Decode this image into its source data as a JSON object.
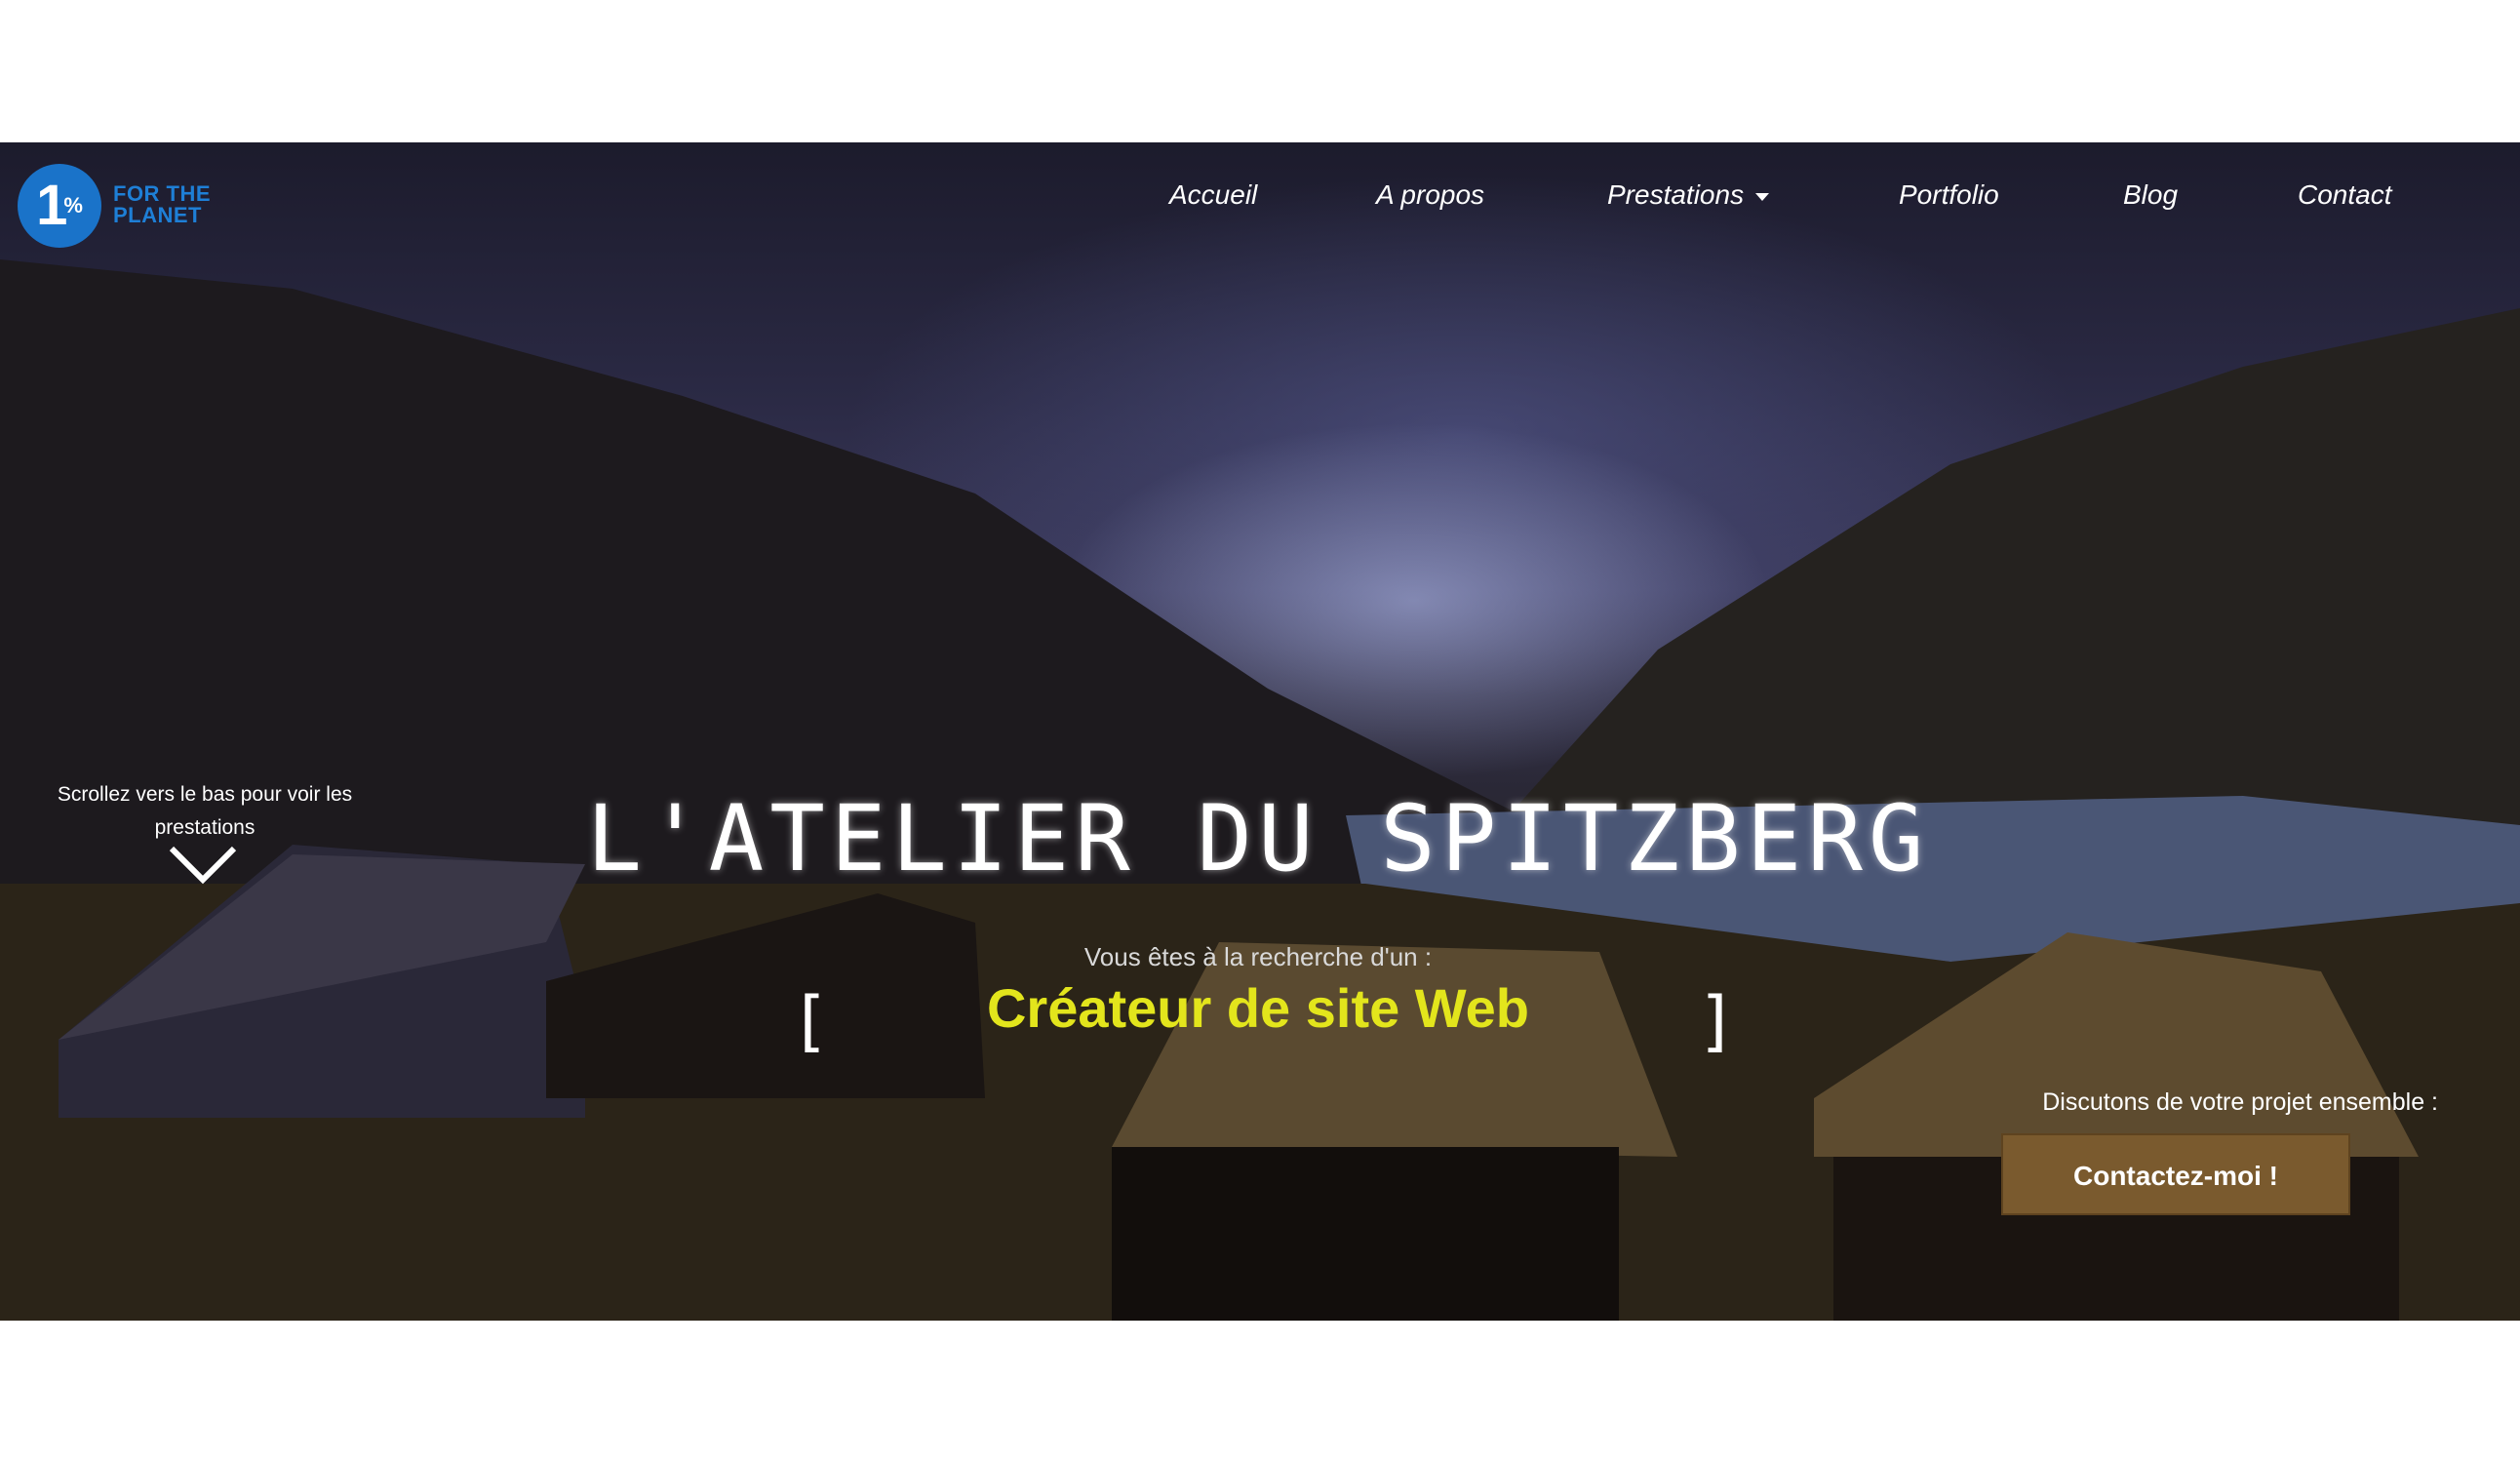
{
  "logo": {
    "badge": "1",
    "badge_pct": "%",
    "line1": "FOR THE",
    "line2": "PLANET"
  },
  "nav": {
    "items": [
      {
        "label": "Accueil"
      },
      {
        "label": "A propos"
      },
      {
        "label": "Prestations",
        "dropdown": true
      },
      {
        "label": "Portfolio"
      },
      {
        "label": "Blog"
      },
      {
        "label": "Contact"
      }
    ]
  },
  "hero": {
    "scroll_hint": "Scrollez vers le bas pour voir les prestations",
    "title": "L'ATELIER DU SPITZBERG",
    "subtitle": "Vous êtes à la recherche d'un :",
    "bracket_open": "[",
    "typed_text": "Créateur de site Web",
    "bracket_close": "]",
    "discuss": "Discutons de votre projet ensemble :",
    "cta_label": "Contactez-moi !"
  },
  "colors": {
    "accent_yellow": "#e3e51c",
    "cta_brown": "#7a5a2e",
    "logo_blue": "#1a73c9"
  },
  "icons": {
    "scroll": "chevron-down-icon"
  }
}
